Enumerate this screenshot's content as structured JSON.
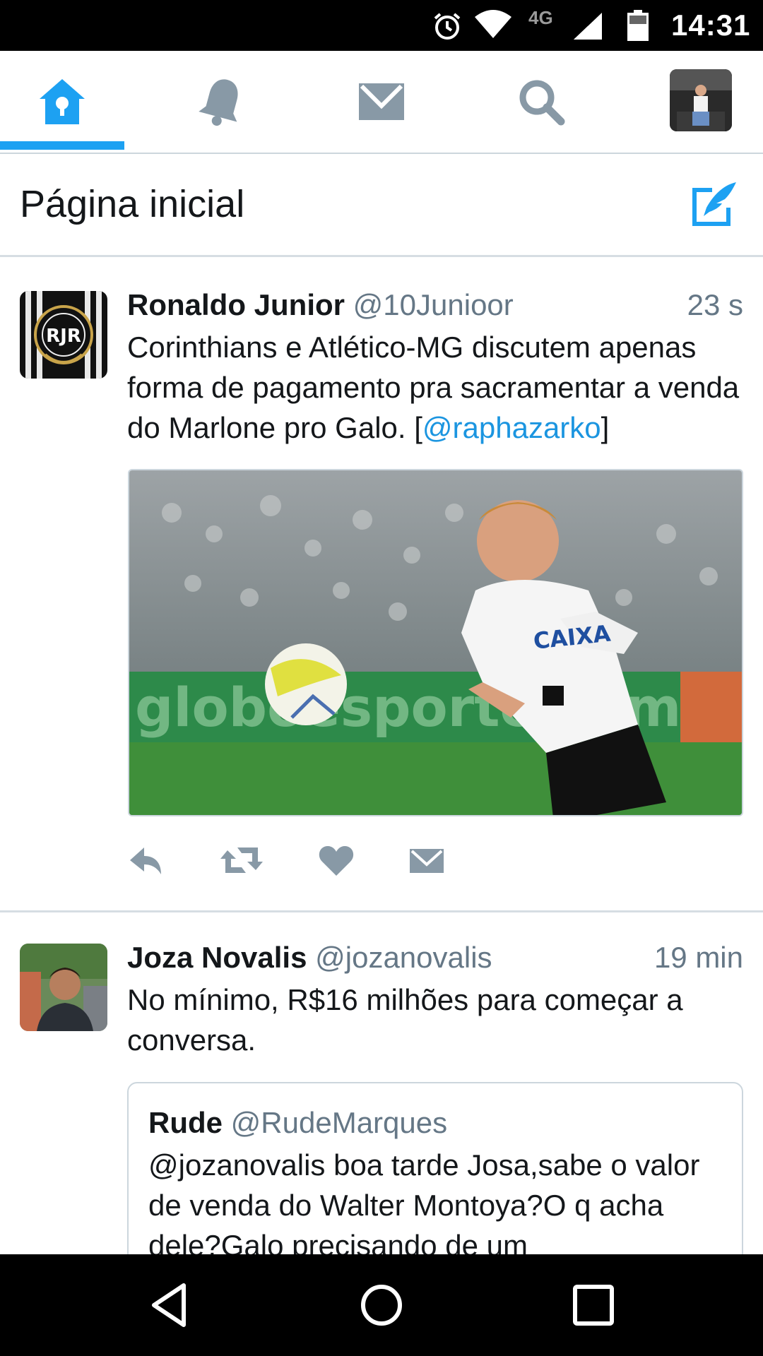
{
  "status_bar": {
    "network": "4G",
    "time": "14:31",
    "icons": [
      "alarm-icon",
      "wifi-icon",
      "signal-icon",
      "battery-icon"
    ]
  },
  "tabs": [
    {
      "name": "home",
      "icon": "home-icon",
      "active": true
    },
    {
      "name": "notifications",
      "icon": "bell-icon",
      "active": false
    },
    {
      "name": "messages",
      "icon": "envelope-icon",
      "active": false
    },
    {
      "name": "search",
      "icon": "search-icon",
      "active": false
    },
    {
      "name": "profile",
      "icon": "avatar",
      "active": false
    }
  ],
  "header": {
    "title": "Página inicial",
    "compose_icon": "compose-icon"
  },
  "tweets": [
    {
      "name": "Ronaldo Junior",
      "handle": "@10Junioor",
      "time": "23 s",
      "text_before": "Corinthians e Atlético-MG discutem apenas forma de pagamento pra sacramentar a venda do Marlone pro Galo. [",
      "mention": "@raphazarko",
      "text_after": "]",
      "avatar_text": "RJR"
    },
    {
      "name": "Joza Novalis",
      "handle": "@jozanovalis",
      "time": "19 min",
      "text": "No mínimo, R$16 milhões para começar a conversa.",
      "quote": {
        "name": "Rude",
        "handle": "@RudeMarques",
        "text": "@jozanovalis boa tarde Josa,sabe o valor de venda do Walter Montoya?O q acha dele?Galo precisando de um"
      }
    }
  ],
  "media_text": {
    "sponsor": "CAIXA",
    "board": "globoesporte.com"
  },
  "colors": {
    "accent": "#1da1f2",
    "text_secondary": "#657786",
    "action_icon": "#8899a6"
  }
}
